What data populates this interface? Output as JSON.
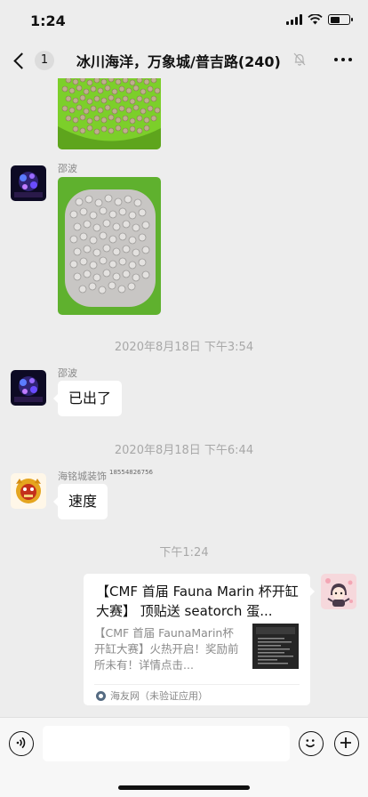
{
  "status_bar": {
    "time": "1:24",
    "battery_level": 0.55
  },
  "nav": {
    "unread_count": "1",
    "title": "冰川海洋，万象城/普吉路(240)",
    "muted": true
  },
  "messages": [
    {
      "type": "image",
      "description": "beige ceramic ring filter media"
    },
    {
      "sender": "邵波",
      "type": "image",
      "description": "white ceramic ring filter media"
    },
    {
      "type": "time",
      "text": "2020年8月18日 下午3:54"
    },
    {
      "sender": "邵波",
      "type": "text",
      "text": "已出了"
    },
    {
      "type": "time",
      "text": "2020年8月18日 下午6:44"
    },
    {
      "sender": "海铭城装饰",
      "sender_tag": "18554826756",
      "type": "text",
      "text": "速度"
    },
    {
      "type": "time",
      "text": "下午1:24"
    },
    {
      "sender": "self",
      "type": "link_card",
      "title": "【CMF 首届 Fauna Marin 杯开缸大赛】 顶贴送 seatorch 蛋...",
      "description": "【CMF 首届 FaunaMarin杯开缸大赛】火热开启！奖励前所未有！详情点击...",
      "source": "海友网（未验证应用）"
    }
  ],
  "colors": {
    "background": "#ededed",
    "bubble": "#ffffff",
    "time_text": "#a8a8a8",
    "green_tray": "#7ccf2a"
  },
  "input_bar": {
    "voice_icon": "voice-icon",
    "emoji_icon": "emoji-icon",
    "plus_icon": "plus-icon",
    "input_value": ""
  }
}
